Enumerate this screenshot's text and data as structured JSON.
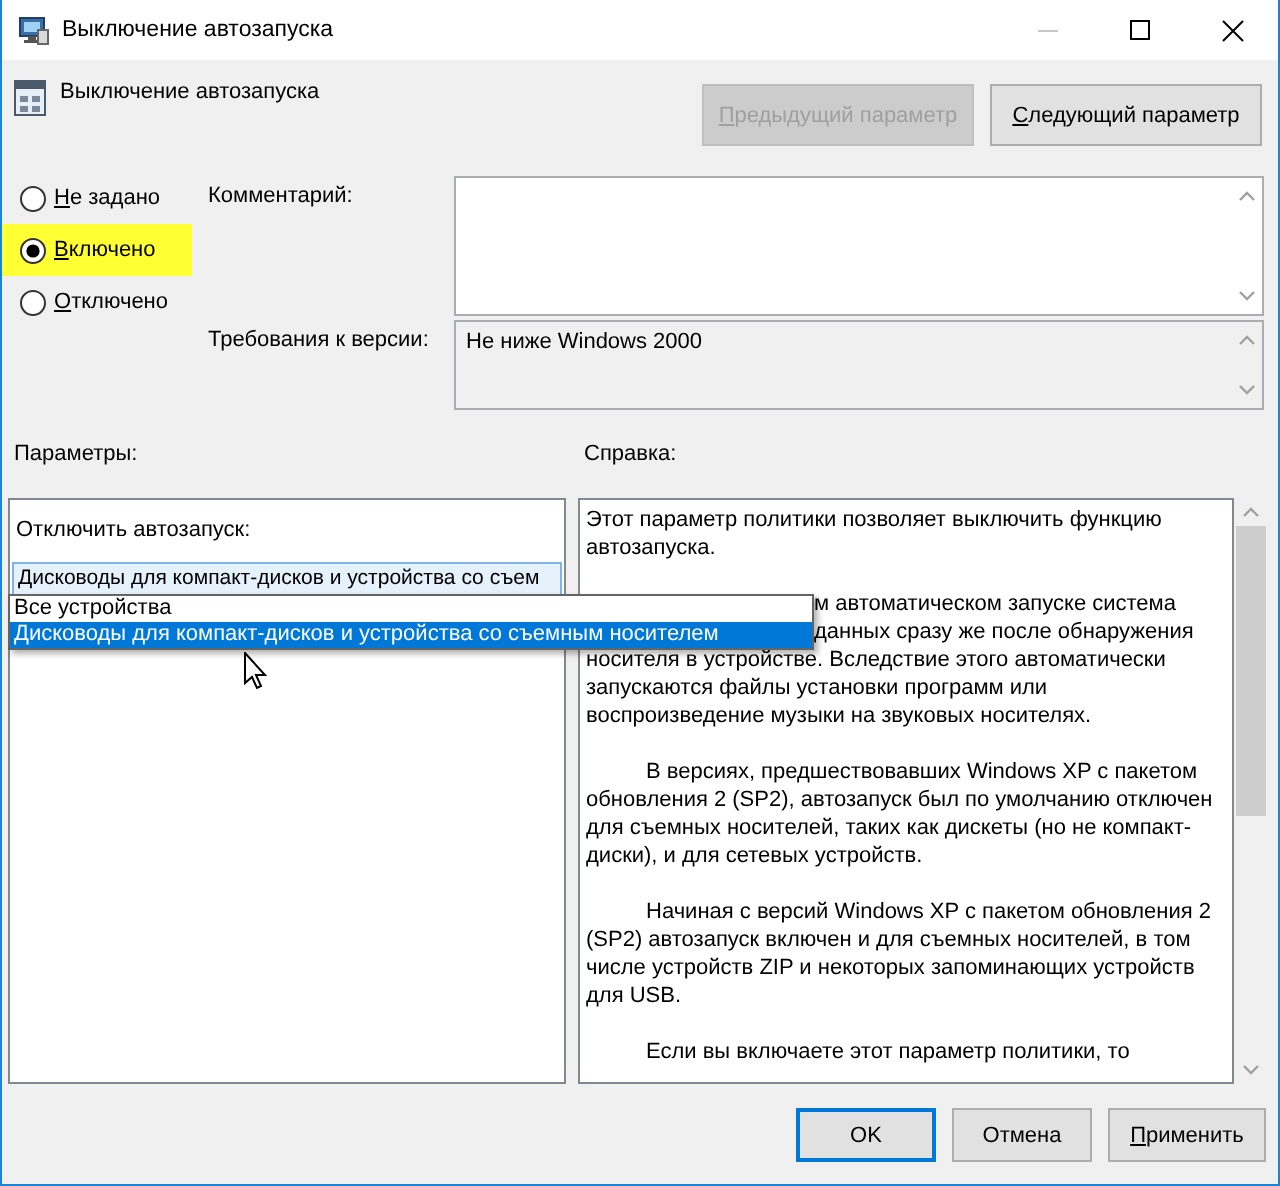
{
  "window": {
    "title": "Выключение автозапуска"
  },
  "header": {
    "title": "Выключение автозапуска"
  },
  "nav_buttons": [
    {
      "label": "Предыдущий параметр",
      "disabled": true,
      "mnemonic": true
    },
    {
      "label": "Следующий параметр",
      "disabled": false,
      "mnemonic": true
    }
  ],
  "state_options": [
    {
      "label": "Не задано",
      "selected": false,
      "highlighted": false,
      "mnemonic": true
    },
    {
      "label": "Включено",
      "selected": true,
      "highlighted": true,
      "mnemonic": true
    },
    {
      "label": "Отключено",
      "selected": false,
      "highlighted": false,
      "mnemonic": true
    }
  ],
  "comment": {
    "label": "Комментарий:"
  },
  "requirements": {
    "label": "Требования к версии:",
    "value": "Не ниже Windows 2000"
  },
  "options": {
    "title": "Параметры:",
    "field_label": "Отключить автозапуск:",
    "combo_value": "Дисководы для компакт-дисков и устройства со съем",
    "dropdown": [
      {
        "label": "Все устройства",
        "selected": false
      },
      {
        "label": "Дисководы для компакт-дисков и устройства со съемным носителем",
        "selected": true
      }
    ]
  },
  "help": {
    "title": "Справка:",
    "paragraphs": [
      {
        "lines": [
          "Этот параметр политики позволяет выключить функцию",
          "автозапуска."
        ]
      },
      {
        "lines": [
          {
            "right": "м автоматическом запуске система"
          },
          {
            "right": "данных сразу же после обнаружения"
          },
          "носителя в устройстве. Вследствие этого автоматически",
          "запускаются файлы установки программ или",
          "воспроизведение музыки на звуковых носителях."
        ]
      },
      {
        "lines": [
          "В версиях, предшествовавших Windows XP с пакетом",
          "обновления 2 (SP2), автозапуск был по умолчанию отключен",
          "для съемных носителей, таких как дискеты (но не компакт-",
          "диски), и для сетевых устройств."
        ]
      },
      {
        "lines": [
          "Начиная с версий Windows XP с пакетом обновления 2",
          "(SP2) автозапуск включен и для съемных носителей, в том",
          "числе устройств ZIP и некоторых запоминающих устройств",
          "для USB."
        ]
      },
      {
        "lines": [
          "Если вы включаете этот параметр политики, то"
        ]
      }
    ]
  },
  "buttons": [
    {
      "label": "OK",
      "default": true,
      "mnemonic": false
    },
    {
      "label": "Отмена",
      "default": false,
      "mnemonic": false
    },
    {
      "label": "Применить",
      "default": false,
      "mnemonic": true
    }
  ]
}
